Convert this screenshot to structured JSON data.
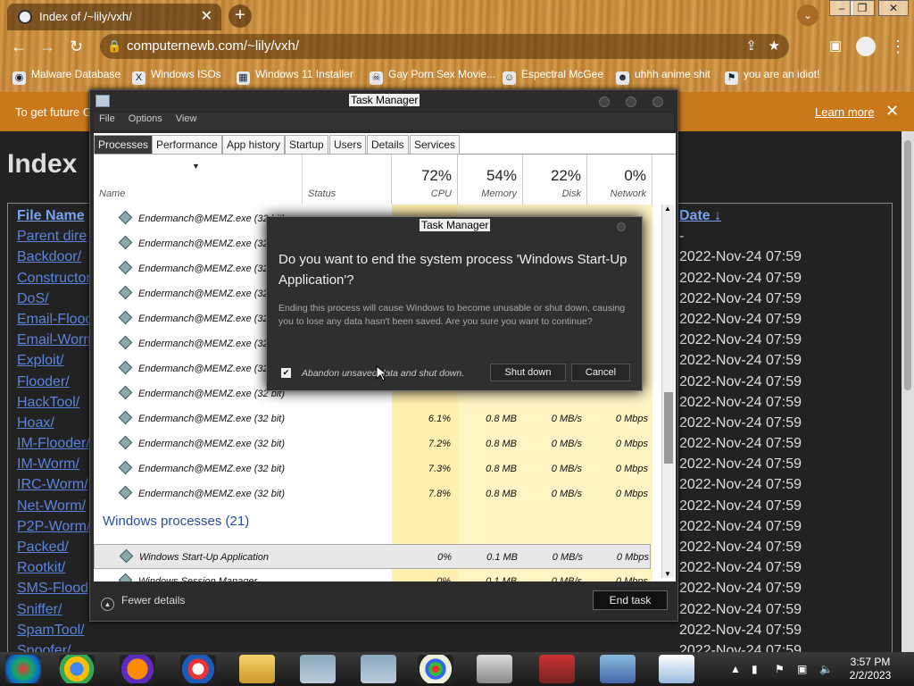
{
  "browser": {
    "tab_title": "Index of /~lily/vxh/",
    "new_tab": "+",
    "url": "computernewb.com/~lily/vxh/",
    "bookmarks": [
      {
        "label": "Malware Database"
      },
      {
        "label": "Windows ISOs"
      },
      {
        "label": "Windows 11 Installer"
      },
      {
        "label": "Gay Porn Sex Movie..."
      },
      {
        "label": "Espectral McGee"
      },
      {
        "label": "uhhh anime shit"
      },
      {
        "label": "you are an idiot!"
      }
    ],
    "infobar_text": "To get future G",
    "infobar_learn_more": "Learn more"
  },
  "page": {
    "heading": "Index",
    "col_name_header": "File Name",
    "col_date_header": "Date",
    "sort_arrow": "↓",
    "entries": [
      {
        "name": "Parent dire",
        "date": "-"
      },
      {
        "name": "Backdoor/",
        "date": "2022-Nov-24 07:59"
      },
      {
        "name": "Constructor",
        "date": "2022-Nov-24 07:59"
      },
      {
        "name": "DoS/",
        "date": "2022-Nov-24 07:59"
      },
      {
        "name": "Email-Flood",
        "date": "2022-Nov-24 07:59"
      },
      {
        "name": "Email-Worm",
        "date": "2022-Nov-24 07:59"
      },
      {
        "name": "Exploit/",
        "date": "2022-Nov-24 07:59"
      },
      {
        "name": "Flooder/",
        "date": "2022-Nov-24 07:59"
      },
      {
        "name": "HackTool/",
        "date": "2022-Nov-24 07:59"
      },
      {
        "name": "Hoax/",
        "date": "2022-Nov-24 07:59"
      },
      {
        "name": "IM-Flooder/",
        "date": "2022-Nov-24 07:59"
      },
      {
        "name": "IM-Worm/",
        "date": "2022-Nov-24 07:59"
      },
      {
        "name": "IRC-Worm/",
        "date": "2022-Nov-24 07:59"
      },
      {
        "name": "Net-Worm/",
        "date": "2022-Nov-24 07:59"
      },
      {
        "name": "P2P-Worm/",
        "date": "2022-Nov-24 07:59"
      },
      {
        "name": "Packed/",
        "date": "2022-Nov-24 07:59"
      },
      {
        "name": "Rootkit/",
        "date": "2022-Nov-24 07:59"
      },
      {
        "name": "SMS-Flood",
        "date": "2022-Nov-24 07:59"
      },
      {
        "name": "Sniffer/",
        "date": "2022-Nov-24 07:59"
      },
      {
        "name": "SpamTool/",
        "date": "2022-Nov-24 07:59"
      },
      {
        "name": "Spoofer/",
        "date": "2022-Nov-24 07:59"
      }
    ]
  },
  "taskmanager": {
    "title": "Task Manager",
    "menu": [
      "File",
      "Options",
      "View"
    ],
    "tabs": [
      "Processes",
      "Performance",
      "App history",
      "Startup",
      "Users",
      "Details",
      "Services"
    ],
    "col_name": "Name",
    "col_status": "Status",
    "cpu_pct": "72%",
    "cpu_label": "CPU",
    "mem_pct": "54%",
    "mem_label": "Memory",
    "disk_pct": "22%",
    "disk_label": "Disk",
    "net_pct": "0%",
    "net_label": "Network",
    "process_rows": [
      {
        "name": "Endermanch@MEMZ.exe (32 bit)",
        "cpu": "",
        "mem": "",
        "disk": "",
        "net": ""
      },
      {
        "name": "Endermanch@MEMZ.exe (32 bit)",
        "cpu": "",
        "mem": "",
        "disk": "",
        "net": ""
      },
      {
        "name": "Endermanch@MEMZ.exe (32 bit)",
        "cpu": "",
        "mem": "",
        "disk": "",
        "net": ""
      },
      {
        "name": "Endermanch@MEMZ.exe (32 bit)",
        "cpu": "",
        "mem": "",
        "disk": "",
        "net": ""
      },
      {
        "name": "Endermanch@MEMZ.exe (32 bit)",
        "cpu": "",
        "mem": "",
        "disk": "",
        "net": ""
      },
      {
        "name": "Endermanch@MEMZ.exe (32 bit)",
        "cpu": "",
        "mem": "",
        "disk": "",
        "net": ""
      },
      {
        "name": "Endermanch@MEMZ.exe (32 bit)",
        "cpu": "",
        "mem": "",
        "disk": "",
        "net": ""
      },
      {
        "name": "Endermanch@MEMZ.exe (32 bit)",
        "cpu": "",
        "mem": "",
        "disk": "",
        "net": ""
      },
      {
        "name": "Endermanch@MEMZ.exe (32 bit)",
        "cpu": "6.1%",
        "mem": "0.8 MB",
        "disk": "0 MB/s",
        "net": "0 Mbps"
      },
      {
        "name": "Endermanch@MEMZ.exe (32 bit)",
        "cpu": "7.2%",
        "mem": "0.8 MB",
        "disk": "0 MB/s",
        "net": "0 Mbps"
      },
      {
        "name": "Endermanch@MEMZ.exe (32 bit)",
        "cpu": "7.3%",
        "mem": "0.8 MB",
        "disk": "0 MB/s",
        "net": "0 Mbps"
      },
      {
        "name": "Endermanch@MEMZ.exe (32 bit)",
        "cpu": "7.8%",
        "mem": "0.8 MB",
        "disk": "0 MB/s",
        "net": "0 Mbps"
      }
    ],
    "group_header": "Windows processes (21)",
    "selected_row": {
      "name": "Windows Start-Up Application",
      "cpu": "0%",
      "mem": "0.1 MB",
      "disk": "0 MB/s",
      "net": "0 Mbps"
    },
    "partial_row": {
      "name": "Windows Session Manager",
      "cpu": "0%",
      "mem": "0.1 MB",
      "disk": "0 MB/s",
      "net": "0 Mbps"
    },
    "fewer_details": "Fewer details",
    "end_task": "End task"
  },
  "dialog": {
    "title": "Task Manager",
    "question": "Do you want to end the system process 'Windows Start-Up Application'?",
    "description": "Ending this process will cause Windows to become unusable or shut down, causing you to lose any data hasn't been saved. Are you sure you want to continue?",
    "checkbox_label": "Abandon unsaved data and shut down.",
    "checkbox_checked": true,
    "shutdown_label": "Shut down",
    "cancel_label": "Cancel"
  },
  "taskbar": {
    "time": "3:57 PM",
    "date": "2/2/2023"
  }
}
